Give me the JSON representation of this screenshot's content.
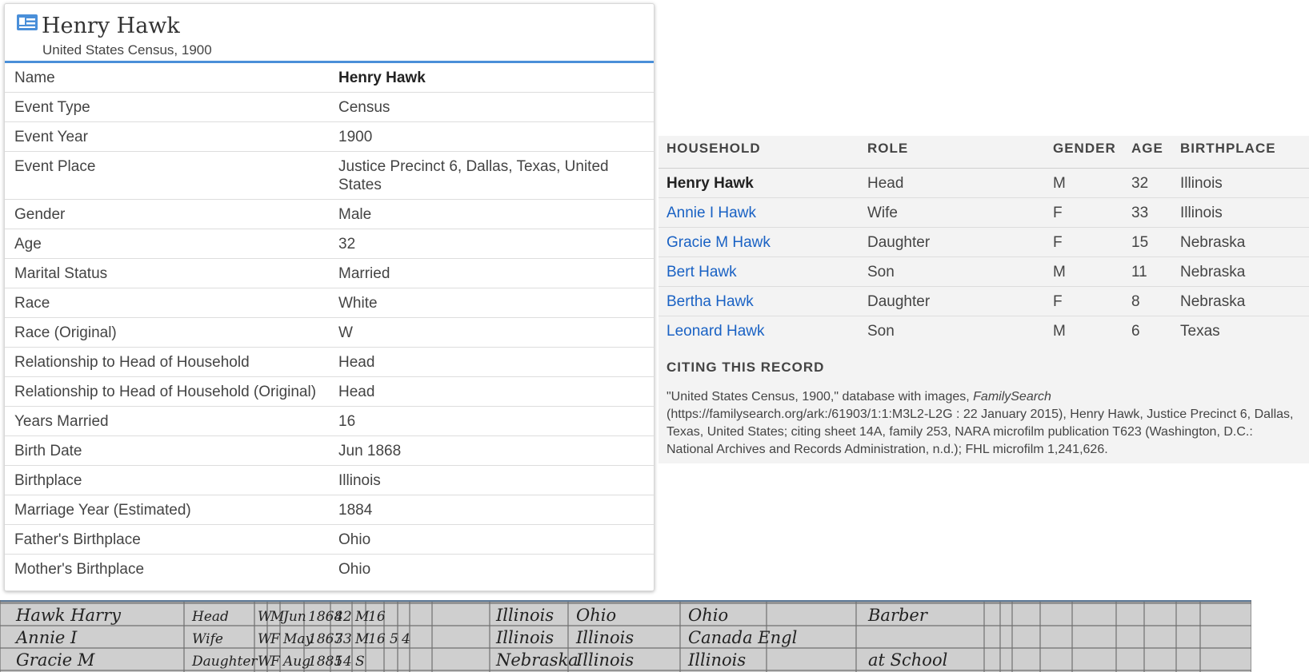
{
  "record": {
    "title": "Henry Hawk",
    "subtitle": "United States Census, 1900",
    "icon": "record-card-icon",
    "facts": [
      {
        "label": "Name",
        "value": "Henry Hawk"
      },
      {
        "label": "Event Type",
        "value": "Census"
      },
      {
        "label": "Event Year",
        "value": "1900"
      },
      {
        "label": "Event Place",
        "value": "Justice Precinct 6, Dallas, Texas, United States"
      },
      {
        "label": "Gender",
        "value": "Male"
      },
      {
        "label": "Age",
        "value": "32"
      },
      {
        "label": "Marital Status",
        "value": "Married"
      },
      {
        "label": "Race",
        "value": "White"
      },
      {
        "label": "Race (Original)",
        "value": "W"
      },
      {
        "label": "Relationship to Head of Household",
        "value": "Head"
      },
      {
        "label": "Relationship to Head of Household (Original)",
        "value": "Head"
      },
      {
        "label": "Years Married",
        "value": "16"
      },
      {
        "label": "Birth Date",
        "value": "Jun 1868"
      },
      {
        "label": "Birthplace",
        "value": "Illinois"
      },
      {
        "label": "Marriage Year (Estimated)",
        "value": "1884"
      },
      {
        "label": "Father's Birthplace",
        "value": "Ohio"
      },
      {
        "label": "Mother's Birthplace",
        "value": "Ohio"
      }
    ]
  },
  "household": {
    "headers": {
      "household": "HOUSEHOLD",
      "role": "ROLE",
      "gender": "GENDER",
      "age": "AGE",
      "birthplace": "BIRTHPLACE"
    },
    "members": [
      {
        "name": "Henry Hawk",
        "role": "Head",
        "gender": "M",
        "age": "32",
        "birthplace": "Illinois"
      },
      {
        "name": "Annie I Hawk",
        "role": "Wife",
        "gender": "F",
        "age": "33",
        "birthplace": "Illinois"
      },
      {
        "name": "Gracie M Hawk",
        "role": "Daughter",
        "gender": "F",
        "age": "15",
        "birthplace": "Nebraska"
      },
      {
        "name": "Bert Hawk",
        "role": "Son",
        "gender": "M",
        "age": "11",
        "birthplace": "Nebraska"
      },
      {
        "name": "Bertha Hawk",
        "role": "Daughter",
        "gender": "F",
        "age": "8",
        "birthplace": "Nebraska"
      },
      {
        "name": "Leonard Hawk",
        "role": "Son",
        "gender": "M",
        "age": "6",
        "birthplace": "Texas"
      }
    ],
    "link_color": "#1a62c4"
  },
  "citation": {
    "heading": "CITING THIS RECORD",
    "text_before": "\"United States Census, 1900,\" database with images, ",
    "source_name": "FamilySearch",
    "text_after": " (https://familysearch.org/ark:/61903/1:1:M3L2-L2G : 22 January 2015), Henry Hawk, Justice Precinct 6, Dallas, Texas, United States; citing sheet 14A, family 253, NARA microfilm publication T623 (Washington, D.C.: National Archives and Records Administration, n.d.); FHL microfilm 1,241,626."
  },
  "census_image": {
    "rows": [
      {
        "name": "Hawk Harry",
        "relation": "Head",
        "race": "W",
        "sex": "M",
        "month": "Jun",
        "year": "1868",
        "age": "42",
        "status": "M",
        "married": "16",
        "birthplace": "Illinois",
        "father": "Ohio",
        "mother": "Ohio",
        "occupation": "Barber"
      },
      {
        "name": "Annie I",
        "relation": "Wife",
        "race": "W",
        "sex": "F",
        "month": "May",
        "year": "1867",
        "age": "33",
        "status": "M",
        "married": "16",
        "children": "5",
        "living": "4",
        "birthplace": "Illinois",
        "father": "Illinois",
        "mother": "Canada Engl"
      },
      {
        "name": "Gracie M",
        "relation": "Daughter",
        "race": "W",
        "sex": "F",
        "month": "Aug",
        "year": "1885",
        "age": "14",
        "status": "S",
        "birthplace": "Nebraska",
        "father": "Illinois",
        "mother": "Illinois",
        "occupation": "at School"
      }
    ],
    "accent": "#4a8fd9"
  }
}
